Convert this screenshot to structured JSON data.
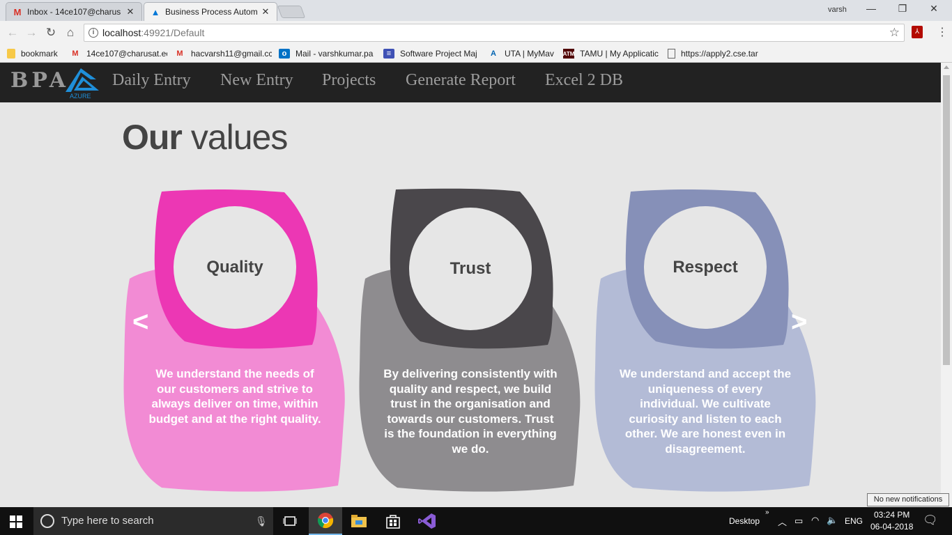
{
  "browser": {
    "tabs": [
      {
        "title": "Inbox - 14ce107@charus",
        "icon": "gmail-icon",
        "active": false
      },
      {
        "title": "Business Process Automa",
        "icon": "azure-icon",
        "active": true
      }
    ],
    "profile_name": "varsh",
    "url_host": "localhost",
    "url_path": ":49921/Default",
    "bookmarks": [
      {
        "label": "bookmark",
        "icon": "folder-icon"
      },
      {
        "label": "14ce107@charusat.ec",
        "icon": "gmail-icon"
      },
      {
        "label": "hacvarsh11@gmail.cc",
        "icon": "gmail-icon"
      },
      {
        "label": "Mail - varshkumar.pa",
        "icon": "outlook-icon"
      },
      {
        "label": "Software Project Maj",
        "icon": "forms-icon"
      },
      {
        "label": "UTA | MyMav",
        "icon": "uta-icon"
      },
      {
        "label": "TAMU | My Applicatic",
        "icon": "tamu-icon"
      },
      {
        "label": "https://apply2.cse.tar",
        "icon": "page-icon"
      }
    ]
  },
  "site": {
    "brand": "BPA",
    "logo_text": "AZURE",
    "nav": [
      "Daily Entry",
      "New Entry",
      "Projects",
      "Generate Report",
      "Excel 2 DB"
    ],
    "heading_bold": "Our",
    "heading_rest": "values",
    "prev_arrow": "<",
    "next_arrow": ">",
    "values": [
      {
        "title": "Quality",
        "text": "We understand the needs of our customers and strive to always deliver on time, within budget and at the right quality.",
        "dark_color": "#ec37b4",
        "light_color": "#f28bd4"
      },
      {
        "title": "Trust",
        "text": "By delivering consistently with quality and respect, we build trust in the organisation and towards our customers. Trust is the foundation in everything we do.",
        "dark_color": "#4a474b",
        "light_color": "#8e8c8f"
      },
      {
        "title": "Respect",
        "text": "We understand and accept the uniqueness of every individual. We cultivate curiosity and listen to each other. We are honest even in disagreement.",
        "dark_color": "#8690b8",
        "light_color": "#b3bbd6"
      }
    ]
  },
  "taskbar": {
    "search_placeholder": "Type here to search",
    "desktop_label": "Desktop",
    "language": "ENG",
    "time": "03:24 PM",
    "date": "06-04-2018",
    "notification": "No new notifications"
  }
}
